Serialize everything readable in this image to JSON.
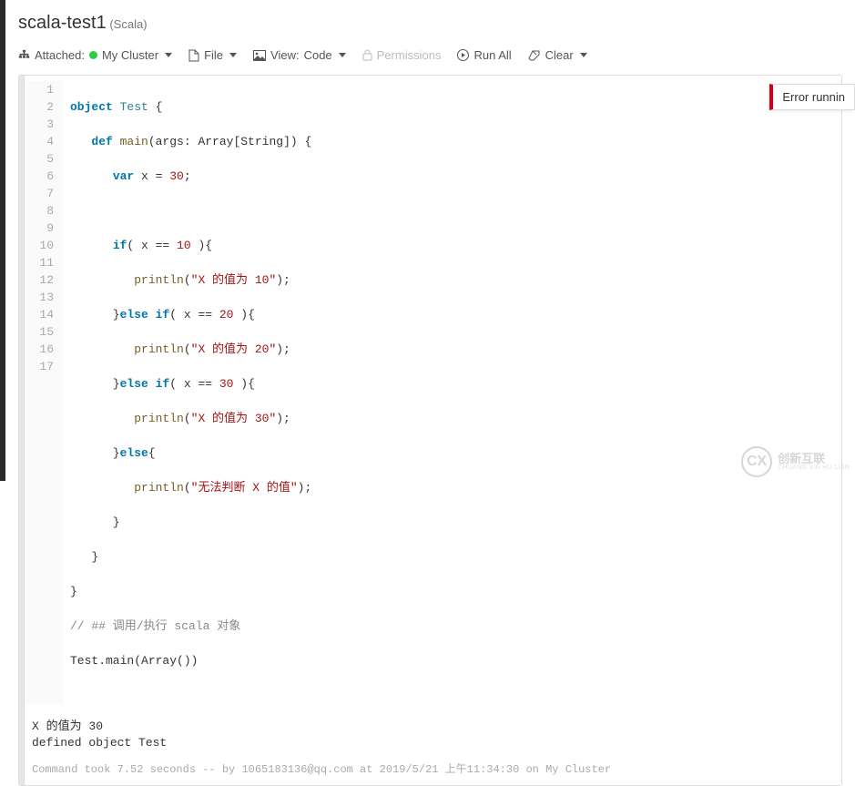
{
  "title": {
    "name": "scala-test1",
    "lang": "(Scala)"
  },
  "toolbar": {
    "attached_label": "Attached:",
    "cluster": "My Cluster",
    "file": "File",
    "view_label": "View:",
    "view_value": "Code",
    "permissions": "Permissions",
    "runall": "Run All",
    "clear": "Clear"
  },
  "code": {
    "lines": [
      {
        "n": "1",
        "t": "object",
        "c": "kw",
        "r": " Test {"
      },
      {
        "n": "2",
        "i": "   ",
        "t1": "def",
        "c1": "kw",
        "m": " main(args: Array[String]) {"
      },
      {
        "n": "3",
        "i": "      ",
        "t1": "var",
        "c1": "kw",
        "m": " x = ",
        "v": "30",
        "r": ";"
      },
      {
        "n": "4",
        "i": ""
      },
      {
        "n": "5",
        "i": "      ",
        "t1": "if",
        "c1": "kw",
        "m": "( x == ",
        "v": "10",
        " r": " ){"
      },
      {
        "n": "6",
        "i": "         ",
        "fn": "println",
        "s": "\"X 的值为 10\"",
        "r": ");"
      },
      {
        "n": "7",
        "i": "      }",
        "t1": "else if",
        "c1": "kw",
        "m": "( x == ",
        "v": "20",
        "r": " ){"
      },
      {
        "n": "8",
        "i": "         ",
        "fn": "println",
        "s": "\"X 的值为 20\"",
        "r": ");"
      },
      {
        "n": "9",
        "i": "      }",
        "t1": "else if",
        "c1": "kw",
        "m": "( x == ",
        "v": "30",
        "r": " ){"
      },
      {
        "n": "10",
        "i": "         ",
        "fn": "println",
        "s": "\"X 的值为 30\"",
        "r": ");"
      },
      {
        "n": "11",
        "i": "      }",
        "t1": "else",
        "c1": "kw",
        "r": "{"
      },
      {
        "n": "12",
        "i": "         ",
        "fn": "println",
        "s": "\"无法判断 X 的值\"",
        "r": ");"
      },
      {
        "n": "13",
        "i": "      }"
      },
      {
        "n": "14",
        "i": "   }"
      },
      {
        "n": "15",
        "i": "}"
      },
      {
        "n": "16",
        "cm": "// ## 调用/执行 scala 对象"
      },
      {
        "n": "17",
        "call": "Test.main(Array())"
      }
    ]
  },
  "output": {
    "line1": "X 的值为 30",
    "line2": "defined object Test"
  },
  "meta": "Command took 7.52 seconds -- by 1065183136@qq.com at 2019/5/21 上午11:34:30 on My Cluster",
  "error": "Error runnin",
  "watermark": {
    "logo": "CX",
    "text": "创新互联",
    "sub": "CHUANG XIN HU LIAN"
  }
}
